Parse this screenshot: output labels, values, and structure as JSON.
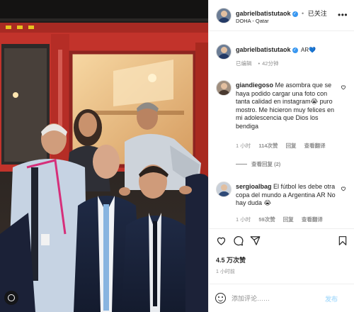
{
  "post": {
    "author": "gabrielbatistutaok",
    "location": "DOHA - Qatar",
    "follow_label": "已关注",
    "follow_separator": "•",
    "verified_mark": "✓",
    "more_mark": "•••"
  },
  "caption": {
    "author": "gabrielbatistutaok",
    "text": "AR💙",
    "edited_label": "已编辑",
    "time": "42分钟"
  },
  "comments": [
    {
      "username": "giandiegoso",
      "text": "Me asombra que se haya podido cargar una foto con tanta calidad en instagram😭 puro mostro. Me hicieron muy felices en mi adolescencia que Dios los bendiga",
      "time": "1 小时",
      "likes": "114次赞",
      "reply": "回复",
      "translate": "查看翻译",
      "view_replies": "查看回复 (2)"
    },
    {
      "username": "sergioalbag",
      "text": "El fútbol les debe otra copa del mundo a Argentina AR No hay duda 😭",
      "time": "1 小时",
      "likes": "59次赞",
      "reply": "回复",
      "translate": "查看翻译"
    }
  ],
  "stats": {
    "likes": "4.5 万次赞",
    "posted_ago": "1 小时前"
  },
  "composer": {
    "placeholder": "添加评论……",
    "post_label": "发布"
  },
  "icons": [
    "heart-icon",
    "comment-icon",
    "share-icon",
    "bookmark-icon",
    "emoji-icon",
    "more-icon",
    "verified-icon"
  ],
  "colors": {
    "accent": "#3897f0",
    "post_disabled": "#b2dffc",
    "muted": "#8e8e8e",
    "truck_red": "#c2332b"
  }
}
